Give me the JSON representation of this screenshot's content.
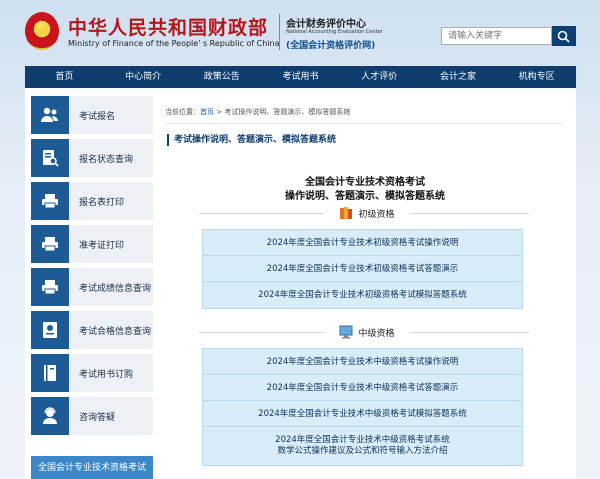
{
  "header": {
    "site_name_cn": "中华人民共和国财政部",
    "site_name_en": "Ministry of Finance of the People' s Republic of China",
    "center_name_cn": "会计财务评价中心",
    "center_name_en": "National Accounting Evaluation Center",
    "center_sub": "(全国会计资格评价网)",
    "search_placeholder": "请输入关键字",
    "search_icon": "search-icon"
  },
  "nav": [
    "首页",
    "中心简介",
    "政策公告",
    "考试用书",
    "人才评价",
    "会计之家",
    "机构专区"
  ],
  "sidebar": {
    "items": [
      {
        "label": "考试报名",
        "icon": "users-icon"
      },
      {
        "label": "报名状态查询",
        "icon": "document-search-icon"
      },
      {
        "label": "报名表打印",
        "icon": "printer-icon"
      },
      {
        "label": "准考证打印",
        "icon": "printer-icon"
      },
      {
        "label": "考试成绩信息查询",
        "icon": "printer-icon"
      },
      {
        "label": "考试合格信息查询",
        "icon": "certificate-icon"
      },
      {
        "label": "考试用书订购",
        "icon": "book-icon"
      },
      {
        "label": "咨询答疑",
        "icon": "user-headset-icon"
      }
    ],
    "footer": "全国会计专业技术资格考试"
  },
  "breadcrumb": {
    "prefix": "当前位置：",
    "home": "首页",
    "sep": " > ",
    "current": "考试操作说明、答题演示、模拟答题系统"
  },
  "section_title": "考试操作说明、答题演示、模拟答题系统",
  "main_title": {
    "line1": "全国会计专业技术资格考试",
    "line2": "操作说明、答题演示、模拟答题系统"
  },
  "categories": [
    {
      "label": "初级资格",
      "icon": "books-icon",
      "links": [
        "2024年度全国会计专业技术初级资格考试操作说明",
        "2024年度全国会计专业技术初级资格考试答题演示",
        "2024年度全国会计专业技术初级资格考试模拟答题系统"
      ]
    },
    {
      "label": "中级资格",
      "icon": "monitor-icon",
      "links": [
        "2024年度全国会计专业技术中级资格考试操作说明",
        "2024年度全国会计专业技术中级资格考试答题演示",
        "2024年度全国会计专业技术中级资格考试模拟答题系统"
      ],
      "extra_link": {
        "line1": "2024年度全国会计专业技术中级资格考试系统",
        "line2": "数学公式操作建议及公式和符号输入方法介绍"
      }
    }
  ],
  "colors": {
    "nav_bg": "#0e3d6e",
    "link_box_bg": "#d9edf8",
    "sidebar_icon_bg": "#1d5b96",
    "brand_red": "#b3171b"
  }
}
